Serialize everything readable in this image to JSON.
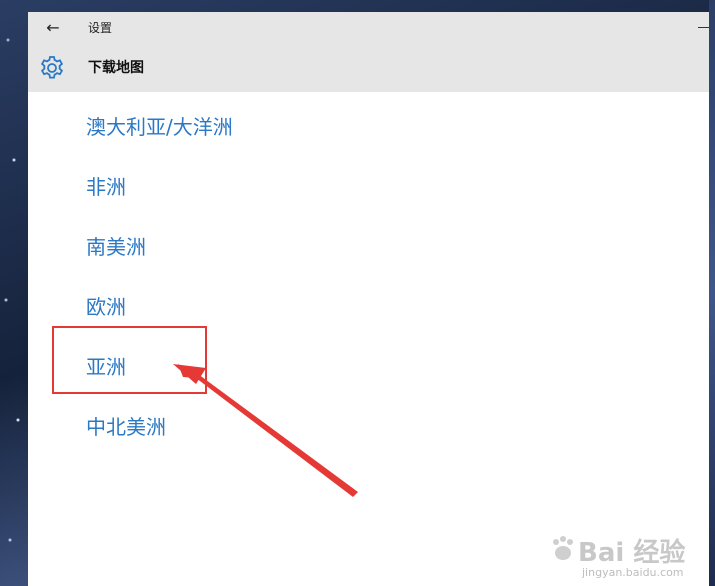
{
  "window": {
    "back_glyph": "←",
    "title": "设置",
    "header_title": "下载地图"
  },
  "regions": [
    {
      "label": "澳大利亚/大洋洲"
    },
    {
      "label": "非洲"
    },
    {
      "label": "南美洲"
    },
    {
      "label": "欧洲"
    },
    {
      "label": "亚洲"
    },
    {
      "label": "中北美洲"
    }
  ],
  "icons": {
    "back": "back-arrow-icon",
    "settings": "gear-icon"
  },
  "colors": {
    "accent": "#2b78c6",
    "annotation": "#e53935",
    "titlebar": "#e6e6e6"
  },
  "watermark": {
    "text": "Bai 经验",
    "url": "jingyan.baidu.com"
  }
}
